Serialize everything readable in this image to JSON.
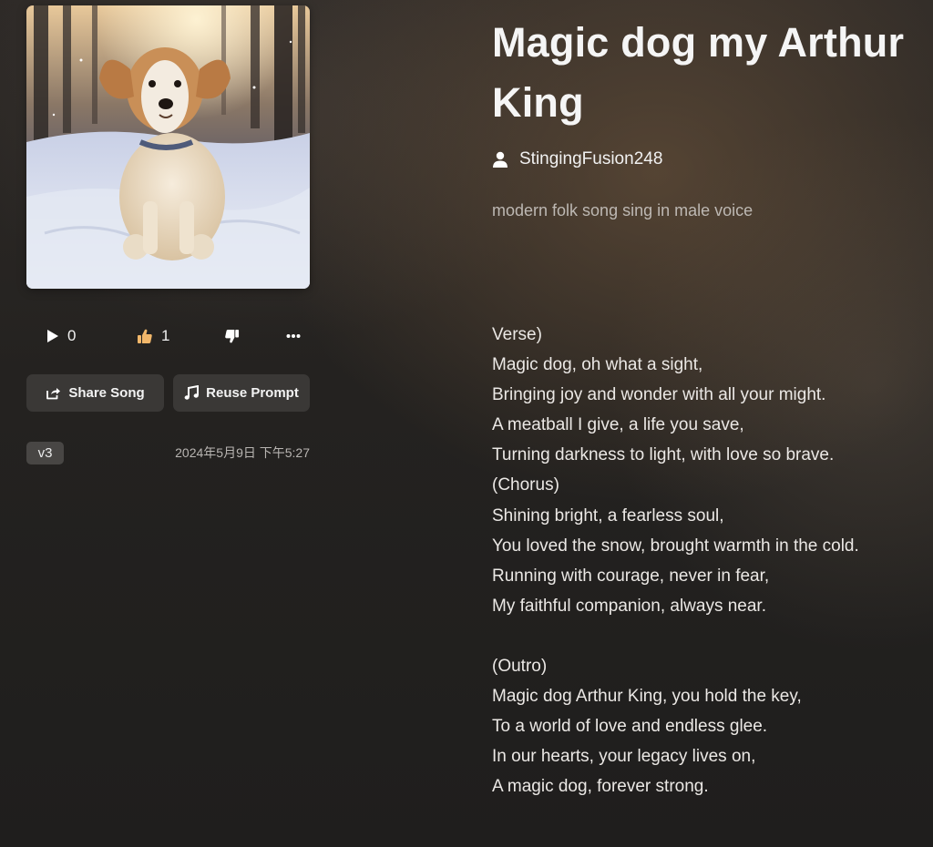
{
  "song": {
    "title": "Magic dog my Arthur King",
    "author": "StingingFusion248",
    "prompt": "modern folk song sing in male voice",
    "cover_alt": "Dog sitting in snowy forest"
  },
  "stats": {
    "plays": "0",
    "likes": "1"
  },
  "icons": {
    "play": "play-icon",
    "like": "thumbs-up-icon",
    "dislike": "thumbs-down-icon",
    "more": "more-icon",
    "share": "share-icon",
    "reuse": "music-note-icon",
    "user": "user-icon"
  },
  "actions": {
    "share_label": "Share Song",
    "reuse_label": "Reuse Prompt"
  },
  "meta": {
    "version": "v3",
    "created": "2024年5月9日 下午5:27"
  },
  "lyrics": [
    "Verse)",
    "Magic dog, oh what a sight,",
    "Bringing joy and wonder with all your might.",
    "A meatball I give, a life you save,",
    "Turning darkness to light, with love so brave.",
    "(Chorus)",
    "Shining bright, a fearless soul,",
    "You loved the snow, brought warmth in the cold.",
    "Running with courage, never in fear,",
    "My faithful companion, always near.",
    "",
    "(Outro)",
    "Magic dog Arthur King, you hold the key,",
    "To a world of love and endless glee.",
    "In our hearts, your legacy lives on,",
    "A magic dog, forever strong."
  ],
  "colors": {
    "like_accent": "#f2b76a",
    "muted_text": "#bdb8b3"
  }
}
